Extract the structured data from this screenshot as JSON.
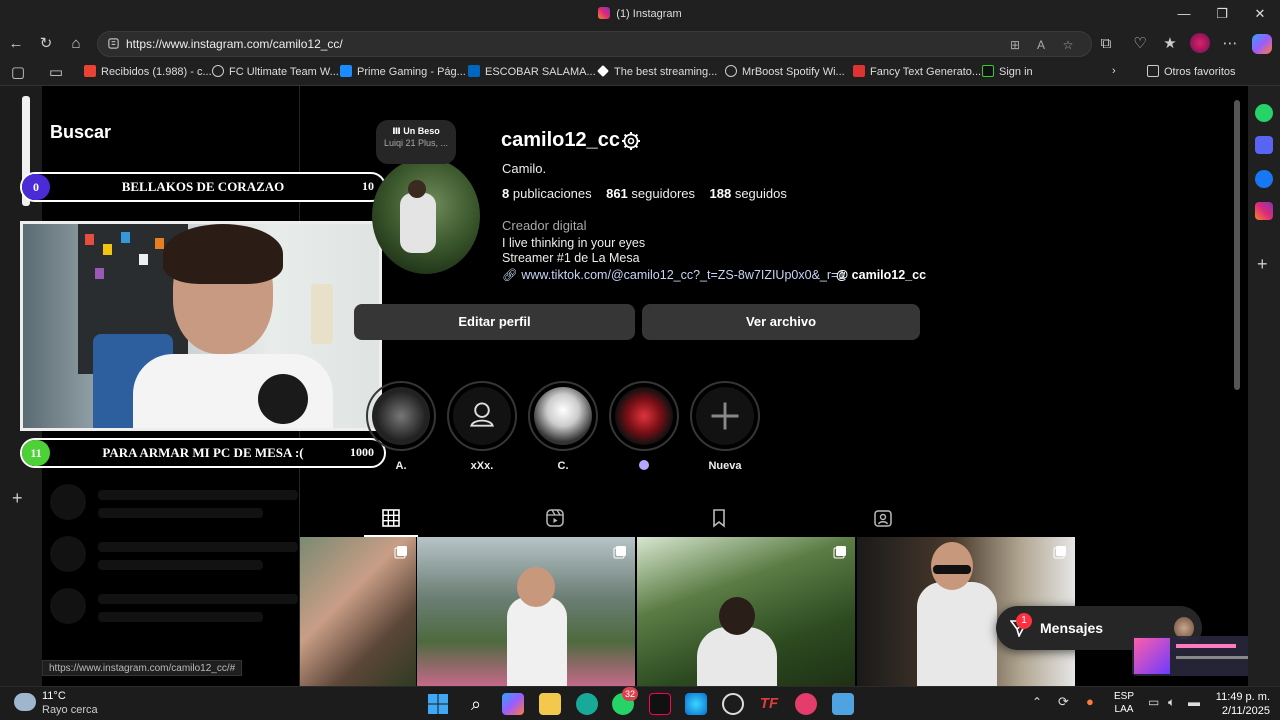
{
  "window": {
    "title": "(1) Instagram"
  },
  "browser": {
    "url": "https://www.instagram.com/camilo12_cc/",
    "bookmarks": [
      "Recibidos (1.988) - c...",
      "FC Ultimate Team W...",
      "Prime Gaming - Pág...",
      "ESCOBAR SALAMA...",
      "The best streaming...",
      "MrBoost Spotify Wi...",
      "Fancy Text Generato...",
      "Sign in"
    ],
    "other_favorites": "Otros favoritos",
    "status_url": "https://www.instagram.com/camilo12_cc/#"
  },
  "search": {
    "heading": "Buscar",
    "placeholder": "Buscar"
  },
  "overlay": {
    "goal1": {
      "current": "0",
      "label": "BELLAKOS DE CORAZAO",
      "target": "10",
      "progress": 0.0
    },
    "goal2": {
      "current": "11",
      "label": "PARA ARMAR MI PC DE MESA :(",
      "target": "1000",
      "progress": 0.011
    }
  },
  "note": {
    "title": "Un Beso",
    "subtitle": "Luiqi 21 Plus, ..."
  },
  "profile": {
    "username": "camilo12_cc",
    "full_name": "Camilo.",
    "posts_count": "8",
    "posts_label": "publicaciones",
    "followers_count": "861",
    "followers_label": "seguidores",
    "following_count": "188",
    "following_label": "seguidos",
    "category": "Creador digital",
    "bio_line1": "I live thinking in your eyes",
    "bio_line2": "Streamer #1 de La Mesa",
    "link": "www.tiktok.com/@camilo12_cc?_t=ZS-8w7IZIUp0x0&_r=1",
    "threads_handle": "camilo12_cc",
    "edit_button": "Editar perfil",
    "archive_button": "Ver archivo"
  },
  "highlights": [
    {
      "label": "A."
    },
    {
      "label": "xXx."
    },
    {
      "label": "C."
    },
    {
      "label": ""
    },
    {
      "label": "Nueva"
    }
  ],
  "messages": {
    "label": "Mensajes",
    "badge": "1"
  },
  "taskbar": {
    "weather_temp": "11°C",
    "weather_desc": "Rayo cerca",
    "whatsapp_badge": "32",
    "lang_line1": "ESP",
    "lang_line2": "LAA",
    "time": "11:49 p. m.",
    "date": "2/11/2025"
  },
  "colors": {
    "accent_link": "#c6d4f5",
    "button_bg": "#363636",
    "goal_green": "#4cd137",
    "goal_purple": "#4b2bd6"
  }
}
